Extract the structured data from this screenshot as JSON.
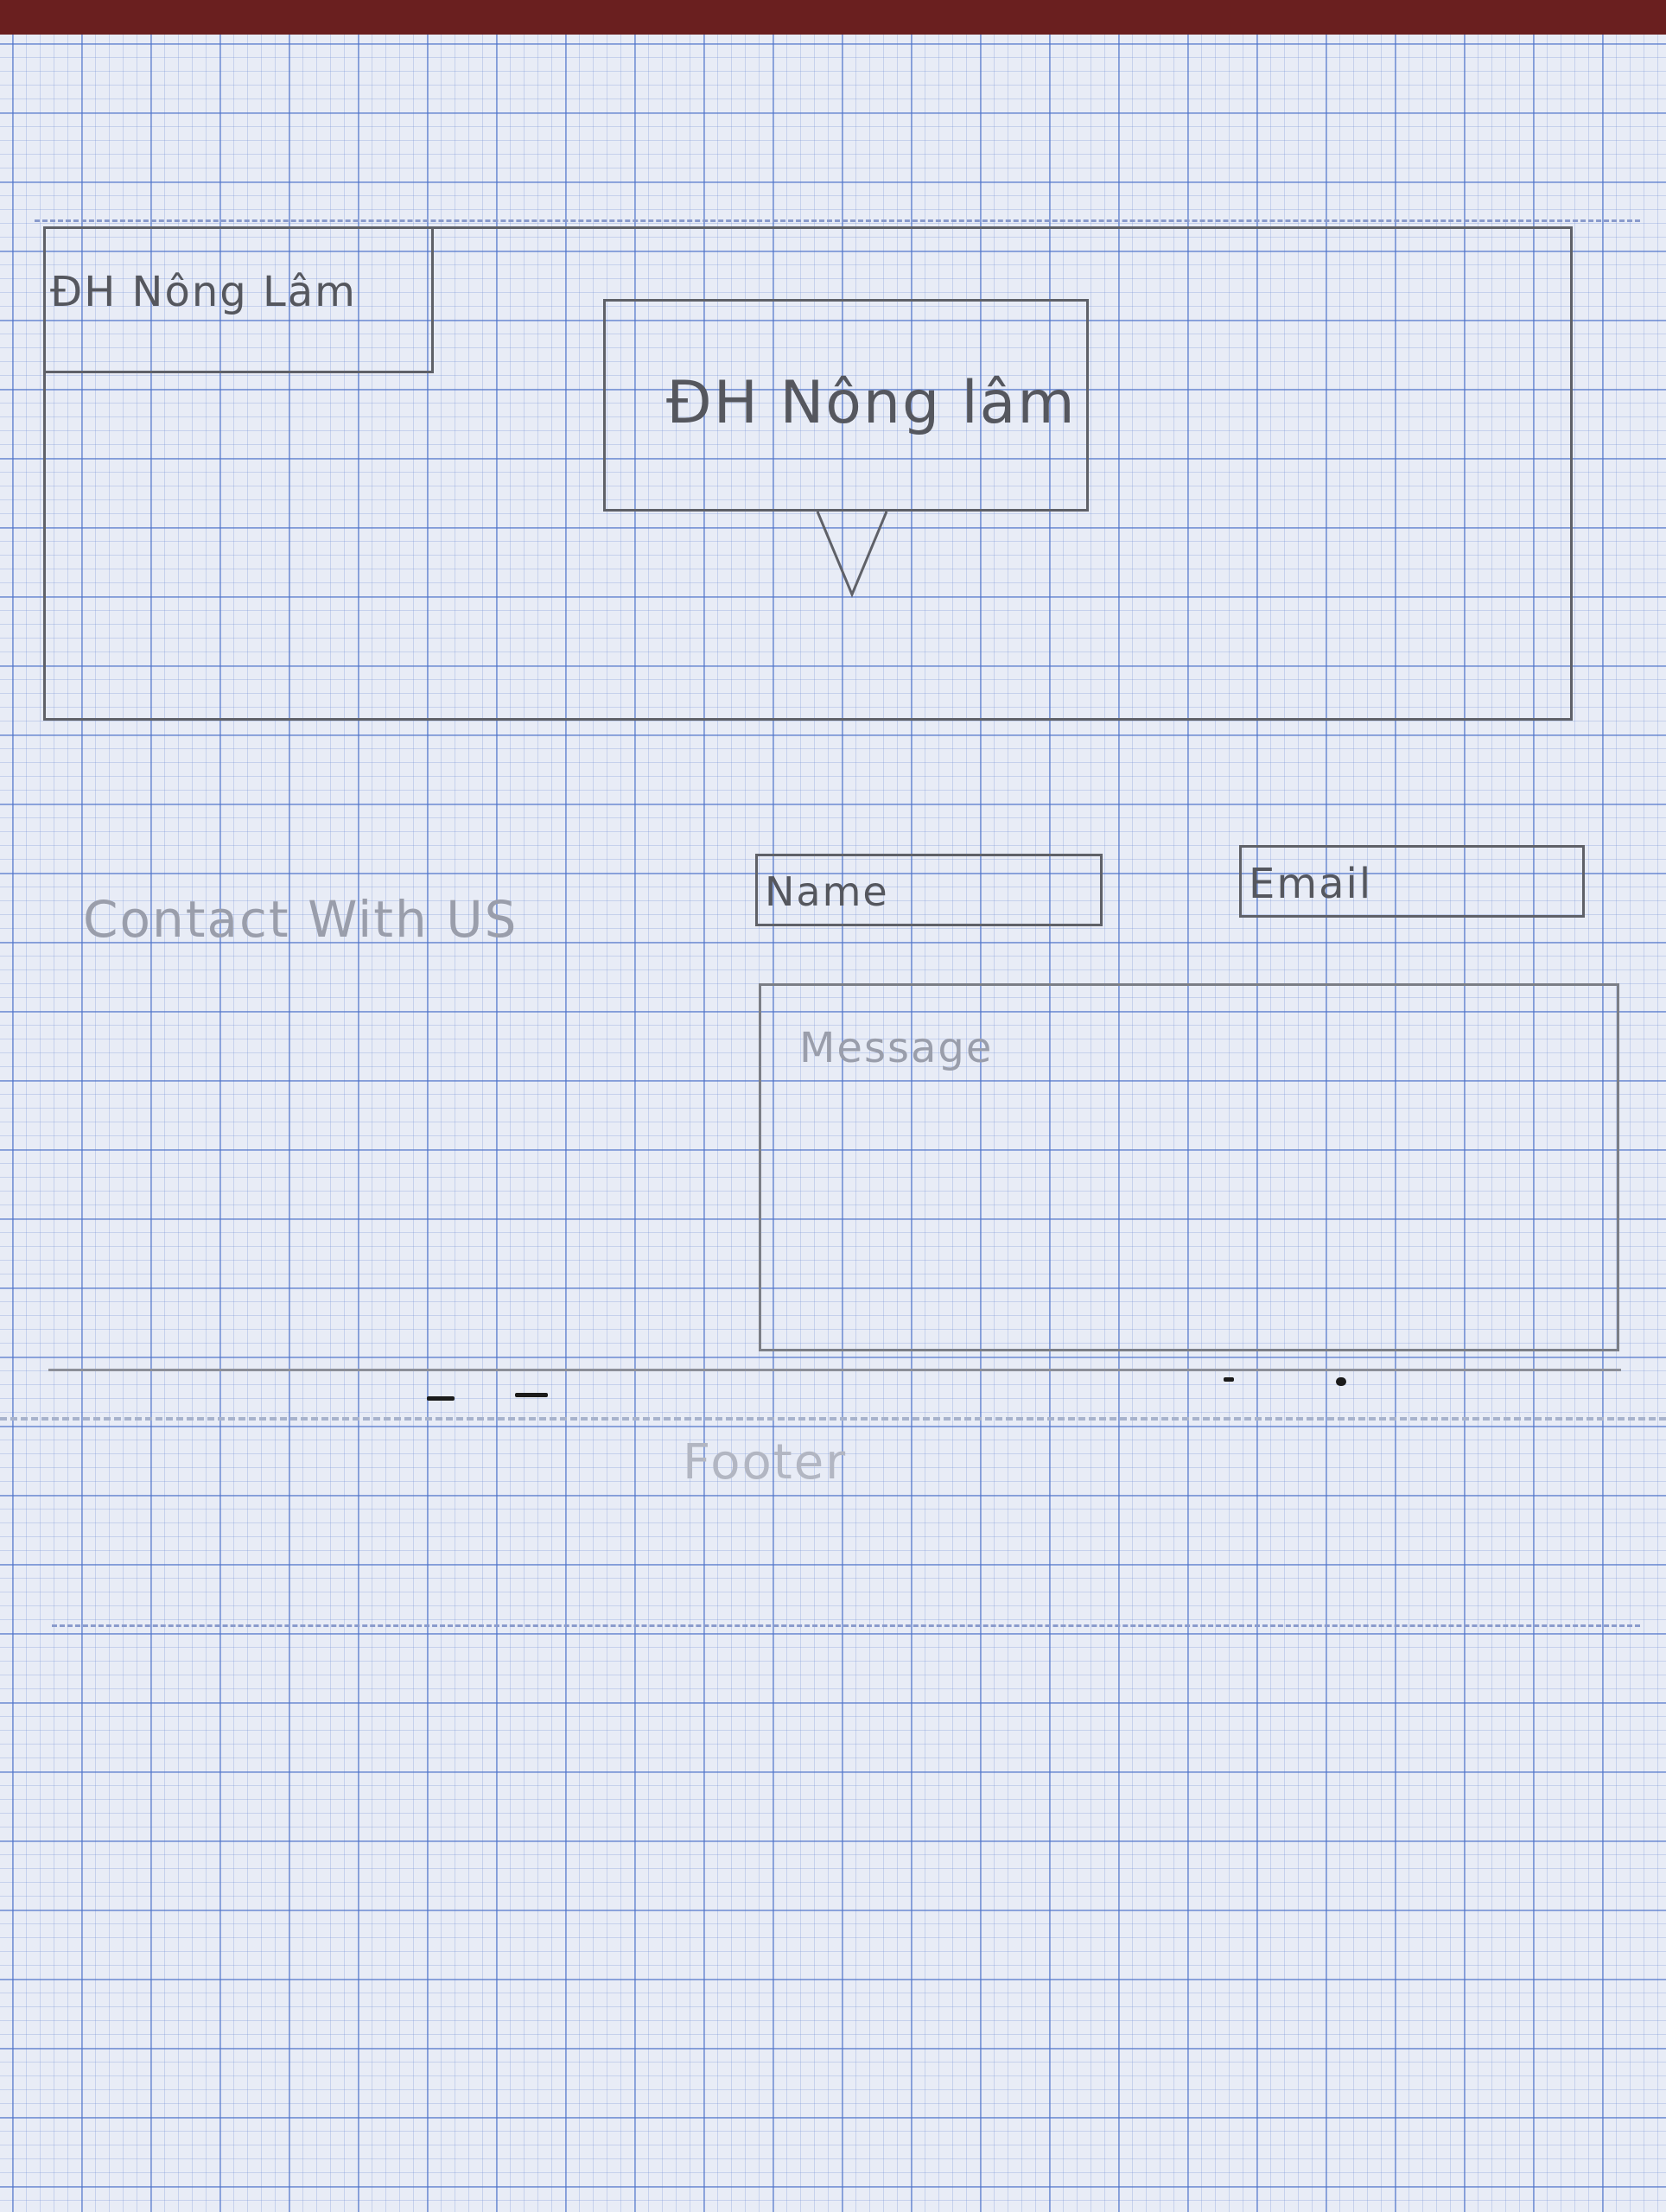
{
  "header": {
    "logo_text": "ĐH Nông Lâm",
    "banner_text": "ĐH Nông lâm"
  },
  "contact": {
    "heading": "Contact With US",
    "name_placeholder": "Name",
    "email_placeholder": "Email",
    "message_placeholder": "Message"
  },
  "footer": {
    "label": "Footer"
  }
}
